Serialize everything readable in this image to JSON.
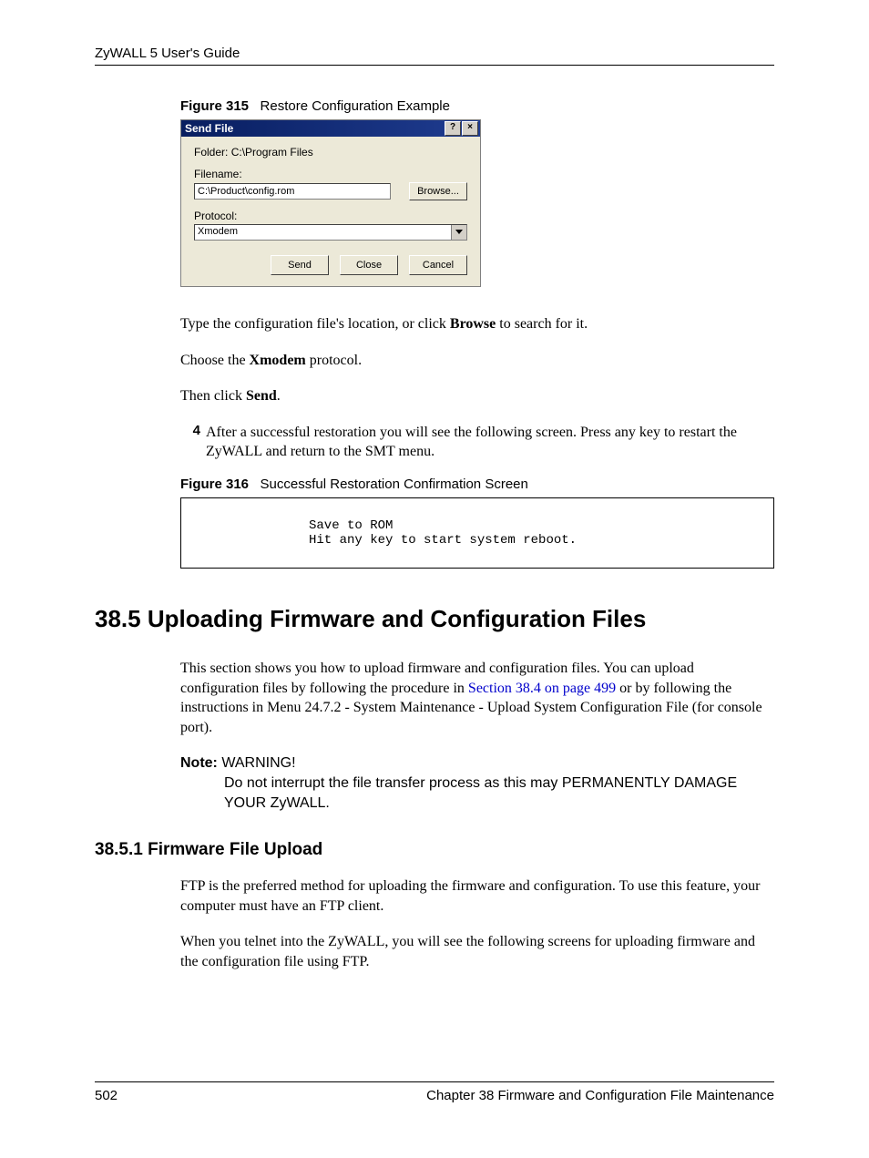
{
  "header": {
    "guide_title": "ZyWALL 5 User's Guide"
  },
  "figure315": {
    "caption_label": "Figure 315",
    "caption_text": "Restore Configuration Example",
    "titlebar": {
      "title": "Send File",
      "help_glyph": "?",
      "close_glyph": "×"
    },
    "folder_label": "Folder:",
    "folder_value": "C:\\Program Files",
    "filename_label": "Filename:",
    "filename_value": "C:\\Product\\config.rom",
    "browse_label": "Browse...",
    "protocol_label": "Protocol:",
    "protocol_value": "Xmodem",
    "buttons": {
      "send": "Send",
      "close": "Close",
      "cancel": "Cancel"
    }
  },
  "para1_pre": "Type the configuration file's location, or click ",
  "para1_bold": "Browse",
  "para1_post": " to search for it.",
  "para2_pre": "Choose the ",
  "para2_bold": "Xmodem",
  "para2_post": " protocol.",
  "para3_pre": "Then click ",
  "para3_bold": "Send",
  "para3_post": ".",
  "step4": {
    "num": "4",
    "text": "After a successful restoration you will see the following screen. Press any key to restart the ZyWALL and return to the SMT menu."
  },
  "figure316": {
    "caption_label": "Figure 316",
    "caption_text": "Successful Restoration Confirmation Screen",
    "terminal_text": "Save to ROM\nHit any key to start system reboot."
  },
  "section_heading": "38.5  Uploading Firmware and Configuration Files",
  "section_para_pre": "This section shows you how to upload firmware and configuration files. You can upload configuration files by following the procedure in ",
  "section_para_link": "Section 38.4 on page 499",
  "section_para_mid": " or by following the instructions in ",
  "section_para_bold": "Menu 24.7.2 - System Maintenance - Upload System Configuration File",
  "section_para_post": " (for console port).",
  "note": {
    "label": "Note:",
    "line1": "WARNING!",
    "body": "Do not interrupt the file transfer process as this may PERMANENTLY DAMAGE YOUR ZyWALL."
  },
  "subsection_heading": "38.5.1  Firmware File Upload",
  "sub_para1": "FTP is the preferred method for uploading the firmware and configuration. To use this feature, your computer must have an FTP client.",
  "sub_para2": "When you telnet into the ZyWALL, you will see the following screens for uploading firmware and the configuration file using FTP.",
  "footer": {
    "page": "502",
    "chapter": "Chapter 38 Firmware and Configuration File Maintenance"
  }
}
